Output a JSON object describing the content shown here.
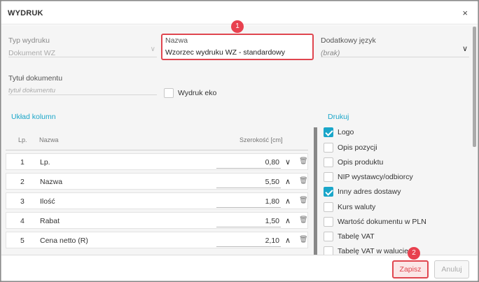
{
  "dialog": {
    "title": "WYDRUK",
    "close_glyph": "×"
  },
  "form": {
    "typ": {
      "label": "Typ wydruku",
      "value": "Dokument WZ"
    },
    "nazwa": {
      "label": "Nazwa",
      "value": "Wzorzec wydruku WZ - standardowy"
    },
    "jezyk": {
      "label": "Dodatkowy język",
      "value": "(brak)"
    },
    "tytul": {
      "label": "Tytuł dokumentu",
      "placeholder": "tytuł dokumentu"
    },
    "eko": {
      "label": "Wydruk eko",
      "checked": false
    }
  },
  "badges": {
    "one": "1",
    "two": "2"
  },
  "columns_section": {
    "title": "Układ kolumn",
    "headers": {
      "lp": "Lp.",
      "nazwa": "Nazwa",
      "szerokosc": "Szerokość [cm]"
    },
    "rows": [
      {
        "lp": "1",
        "nazwa": "Lp.",
        "szerokosc": "0,80",
        "arrow": "down"
      },
      {
        "lp": "2",
        "nazwa": "Nazwa",
        "szerokosc": "5,50",
        "arrow": "up"
      },
      {
        "lp": "3",
        "nazwa": "Ilość",
        "szerokosc": "1,80",
        "arrow": "up"
      },
      {
        "lp": "4",
        "nazwa": "Rabat",
        "szerokosc": "1,50",
        "arrow": "up"
      },
      {
        "lp": "5",
        "nazwa": "Cena netto (R)",
        "szerokosc": "2,10",
        "arrow": "up"
      }
    ]
  },
  "print_section": {
    "title": "Drukuj",
    "items": [
      {
        "label": "Logo",
        "checked": true
      },
      {
        "label": "Opis pozycji",
        "checked": false
      },
      {
        "label": "Opis produktu",
        "checked": false
      },
      {
        "label": "NIP wystawcy/odbiorcy",
        "checked": false
      },
      {
        "label": "Inny adres dostawy",
        "checked": true
      },
      {
        "label": "Kurs waluty",
        "checked": false
      },
      {
        "label": "Wartość dokumentu w PLN",
        "checked": false
      },
      {
        "label": "Tabelę VAT",
        "checked": false
      },
      {
        "label": "Tabelę VAT w walucie",
        "checked": false
      }
    ]
  },
  "footer": {
    "save_label": "Zapisz",
    "cancel_label": "Anuluj"
  },
  "colors": {
    "accent": "#1aa6c9",
    "highlight": "#e0464f"
  }
}
